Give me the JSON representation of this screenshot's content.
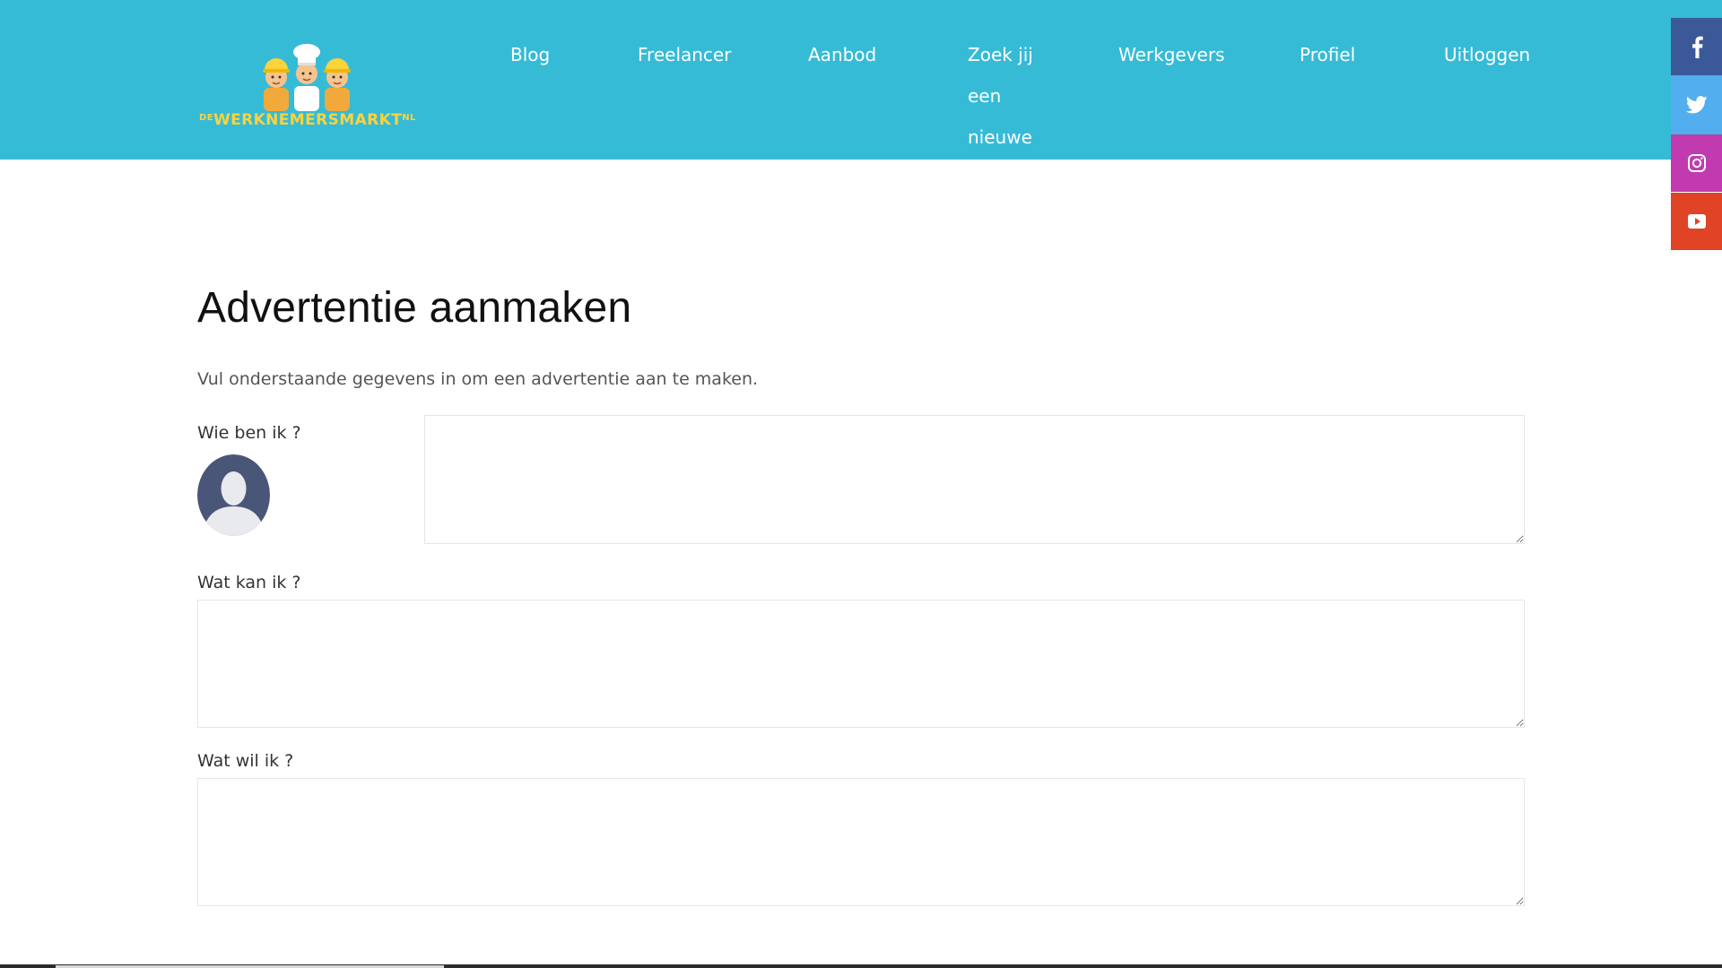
{
  "logo": {
    "prefix": "DE",
    "name": "WERKNEMERSMARKT",
    "suffix": "NL"
  },
  "nav": {
    "blog": "Blog",
    "freelancer": "Freelancer",
    "aanbod": "Aanbod",
    "zoek": "Zoek jij een nieuwe",
    "werkgevers": "Werkgevers",
    "profiel": "Profiel",
    "uitloggen": "Uitloggen"
  },
  "social": [
    {
      "icon": "facebook-icon",
      "color": "#3b5998"
    },
    {
      "icon": "twitter-icon",
      "color": "#52aeee"
    },
    {
      "icon": "instagram-icon",
      "color": "#c13ab0"
    },
    {
      "icon": "youtube-icon",
      "color": "#e14326"
    }
  ],
  "colors": {
    "header": "#36bbd7",
    "logo_text": "#fbd33b",
    "avatar": "#4a5677"
  },
  "form": {
    "title": "Advertentie aanmaken",
    "intro": "Vul onderstaande gegevens in om een advertentie aan te maken.",
    "fields": [
      {
        "label": "Wie ben ik ?",
        "value": ""
      },
      {
        "label": "Wat kan ik ?",
        "value": ""
      },
      {
        "label": "Wat wil ik ?",
        "value": ""
      }
    ]
  }
}
